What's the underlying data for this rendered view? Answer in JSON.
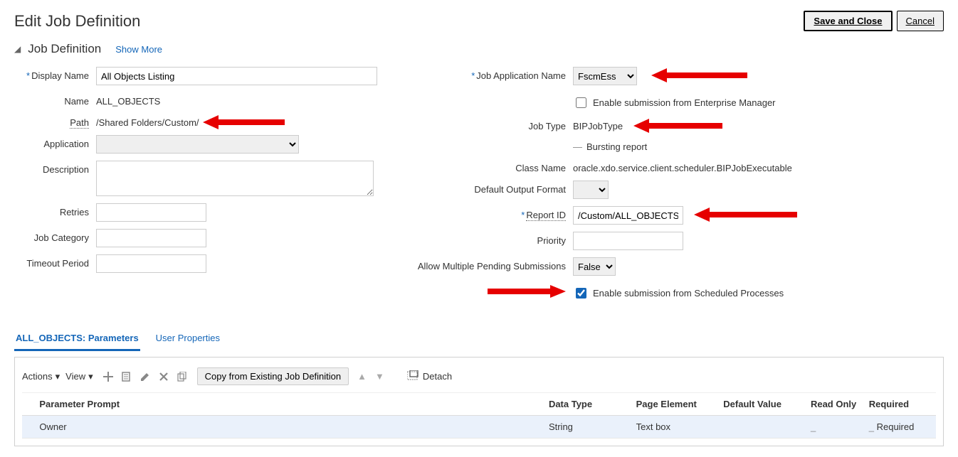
{
  "header": {
    "title": "Edit Job Definition",
    "save_close": "Save and Close",
    "cancel": "Cancel"
  },
  "section": {
    "title": "Job Definition",
    "show_more": "Show More"
  },
  "left": {
    "display_name_label": "Display Name",
    "display_name_value": "All Objects Listing",
    "name_label": "Name",
    "name_value": "ALL_OBJECTS",
    "path_label": "Path",
    "path_value": "/Shared Folders/Custom/",
    "application_label": "Application",
    "application_value": "",
    "description_label": "Description",
    "description_value": "",
    "retries_label": "Retries",
    "retries_value": "",
    "job_category_label": "Job Category",
    "job_category_value": "",
    "timeout_label": "Timeout Period",
    "timeout_value": ""
  },
  "right": {
    "job_app_name_label": "Job Application Name",
    "job_app_name_value": "FscmEss",
    "enable_em_label": "Enable submission from Enterprise Manager",
    "job_type_label": "Job Type",
    "job_type_value": "BIPJobType",
    "bursting_label": "Bursting report",
    "class_name_label": "Class Name",
    "class_name_value": "oracle.xdo.service.client.scheduler.BIPJobExecutable",
    "default_output_label": "Default Output Format",
    "default_output_value": "",
    "report_id_label": "Report ID",
    "report_id_value": "/Custom/ALL_OBJECTS_R",
    "priority_label": "Priority",
    "priority_value": "",
    "allow_multi_label": "Allow Multiple Pending Submissions",
    "allow_multi_value": "False",
    "enable_sched_label": "Enable submission from Scheduled Processes"
  },
  "tabs": {
    "parameters": "ALL_OBJECTS: Parameters",
    "user_props": "User Properties"
  },
  "toolbar": {
    "actions": "Actions",
    "view": "View",
    "copy_btn": "Copy from Existing Job Definition",
    "detach": "Detach"
  },
  "table": {
    "headers": {
      "prompt": "Parameter Prompt",
      "data_type": "Data Type",
      "page_elem": "Page Element",
      "default_val": "Default Value",
      "read_only": "Read Only",
      "required": "Required"
    },
    "rows": [
      {
        "prompt": "Owner",
        "data_type": "String",
        "page_elem": "Text box",
        "default_val": "",
        "read_only": "_",
        "required": "Required"
      }
    ]
  }
}
